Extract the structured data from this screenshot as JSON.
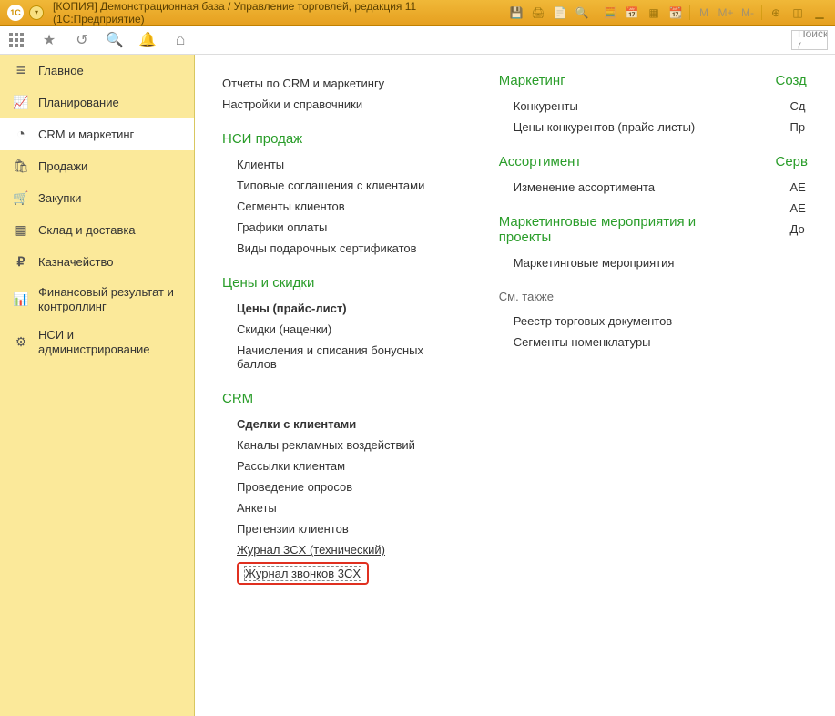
{
  "titlebar": {
    "logo_text": "1C",
    "title": "[КОПИЯ] Демонстрационная база / Управление торговлей, редакция 11  (1С:Предприятие)",
    "tools": {
      "m": "M",
      "mplus": "M+",
      "mminus": "M-"
    }
  },
  "toolbar": {
    "search_placeholder": "Поиск ("
  },
  "sidebar": {
    "items": [
      {
        "id": "main",
        "label": "Главное"
      },
      {
        "id": "planning",
        "label": "Планирование"
      },
      {
        "id": "crm",
        "label": "CRM и маркетинг"
      },
      {
        "id": "sales",
        "label": "Продажи"
      },
      {
        "id": "purchases",
        "label": "Закупки"
      },
      {
        "id": "warehouse",
        "label": "Склад и доставка"
      },
      {
        "id": "treasury",
        "label": "Казначейство"
      },
      {
        "id": "finresult",
        "label": "Финансовый результат и контроллинг"
      },
      {
        "id": "nsi",
        "label": "НСИ и администрирование"
      }
    ]
  },
  "content": {
    "col1": {
      "top_links": [
        "Отчеты по CRM и маркетингу",
        "Настройки и справочники"
      ],
      "sections": [
        {
          "title": "НСИ продаж",
          "items": [
            {
              "text": "Клиенты"
            },
            {
              "text": "Типовые соглашения с клиентами"
            },
            {
              "text": "Сегменты клиентов"
            },
            {
              "text": "Графики оплаты"
            },
            {
              "text": "Виды подарочных сертификатов"
            }
          ]
        },
        {
          "title": "Цены и скидки",
          "items": [
            {
              "text": "Цены (прайс-лист)",
              "bold": true
            },
            {
              "text": "Скидки (наценки)"
            },
            {
              "text": "Начисления и списания бонусных баллов"
            }
          ]
        },
        {
          "title": "CRM",
          "items": [
            {
              "text": "Сделки с клиентами",
              "bold": true
            },
            {
              "text": "Каналы рекламных воздействий"
            },
            {
              "text": "Рассылки клиентам"
            },
            {
              "text": "Проведение опросов"
            },
            {
              "text": "Анкеты"
            },
            {
              "text": "Претензии клиентов"
            },
            {
              "text": "Журнал 3CX (технический)",
              "underline": true
            },
            {
              "text": "Журнал звонков 3CX",
              "highlighted": true
            }
          ]
        }
      ]
    },
    "col2": {
      "sections": [
        {
          "title": "Маркетинг",
          "items": [
            {
              "text": "Конкуренты"
            },
            {
              "text": "Цены конкурентов (прайс-листы)"
            }
          ]
        },
        {
          "title": "Ассортимент",
          "items": [
            {
              "text": "Изменение ассортимента"
            }
          ]
        },
        {
          "title": "Маркетинговые мероприятия и проекты",
          "items": [
            {
              "text": "Маркетинговые мероприятия"
            }
          ]
        }
      ],
      "see_also": {
        "label": "См. также",
        "items": [
          {
            "text": "Реестр торговых документов"
          },
          {
            "text": "Сегменты номенклатуры"
          }
        ]
      }
    },
    "col3": {
      "sections": [
        {
          "title": "Созд",
          "items": [
            {
              "text": "Сд"
            },
            {
              "text": "Пр"
            }
          ]
        },
        {
          "title": "Серв",
          "items": [
            {
              "text": "АЕ"
            },
            {
              "text": "АЕ"
            },
            {
              "text": "До"
            }
          ]
        }
      ]
    }
  }
}
